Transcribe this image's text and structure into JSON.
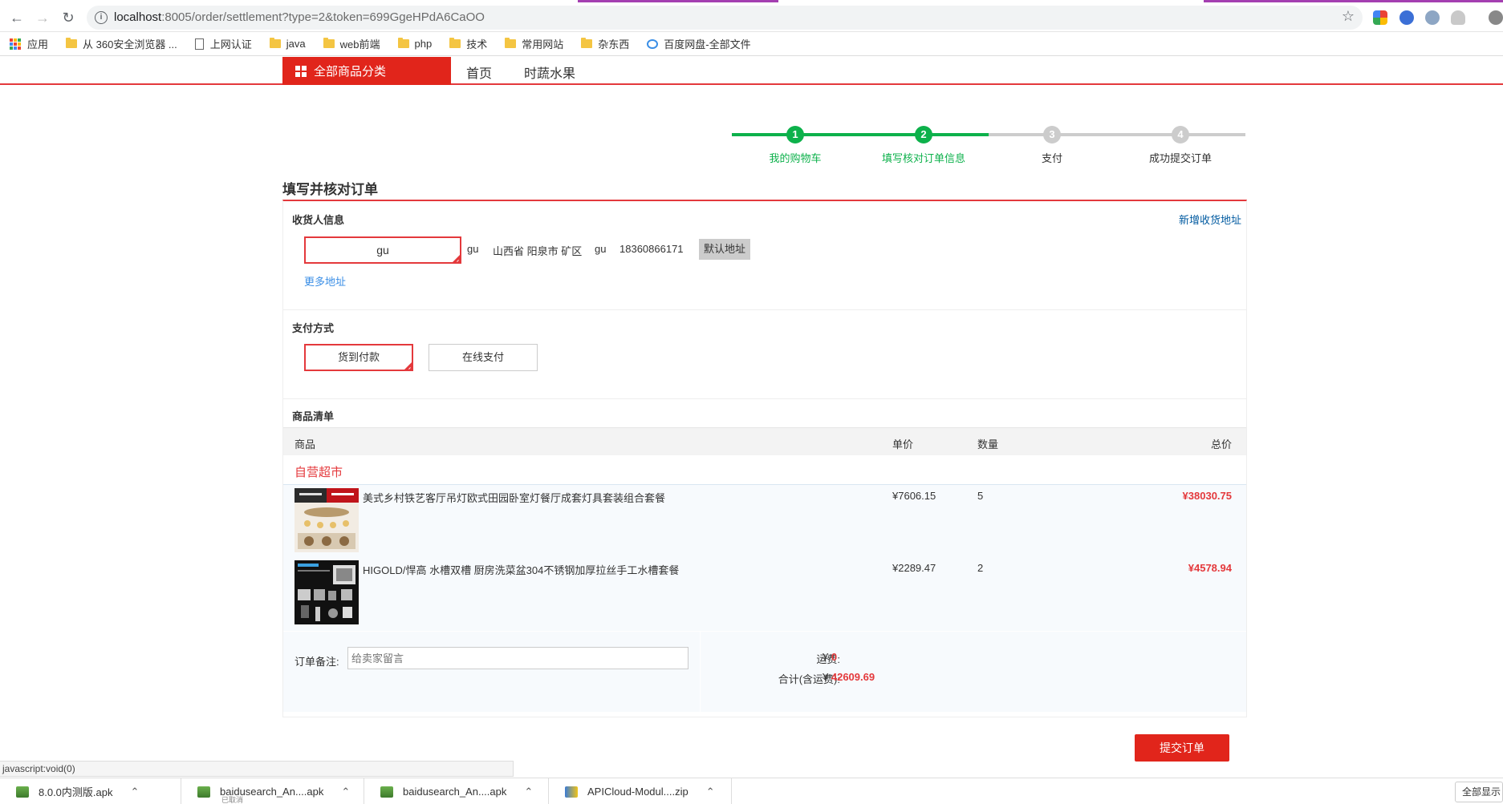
{
  "browser": {
    "url_host": "localhost",
    "url_rest": ":8005/order/settlement?type=2&token=699GgeHPdA6CaOO",
    "bookmarks": [
      "应用",
      "从 360安全浏览器 ...",
      "上网认证",
      "java",
      "web前端",
      "php",
      "技术",
      "常用网站",
      "杂东西",
      "百度网盘-全部文件"
    ]
  },
  "site_nav": {
    "category_label": "全部商品分类",
    "links": [
      "首页",
      "时蔬水果"
    ]
  },
  "stepper": {
    "steps": [
      {
        "num": "1",
        "label": "我的购物车"
      },
      {
        "num": "2",
        "label": "填写核对订单信息"
      },
      {
        "num": "3",
        "label": "支付"
      },
      {
        "num": "4",
        "label": "成功提交订单"
      }
    ],
    "current_step": 2,
    "done_color": "#0db14b",
    "todo_color": "#cccccc"
  },
  "page_title": "填写并核对订单",
  "consignee": {
    "title": "收货人信息",
    "add_link": "新增收货地址",
    "selected_name": "gu",
    "name": "gu",
    "region": "山西省 阳泉市 矿区",
    "detail": "gu",
    "phone": "18360866171",
    "default_badge": "默认地址",
    "more_link": "更多地址"
  },
  "payment": {
    "title": "支付方式",
    "options": [
      "货到付款",
      "在线支付"
    ],
    "selected": "货到付款"
  },
  "goods": {
    "title": "商品清单",
    "headers": {
      "product": "商品",
      "price": "单价",
      "qty": "数量",
      "total": "总价"
    },
    "shop_name": "自营超市",
    "items": [
      {
        "name": "美式乡村铁艺客厅吊灯欧式田园卧室灯餐厅成套灯具套装组合套餐",
        "price": "¥7606.15",
        "qty": "5",
        "total": "¥38030.75"
      },
      {
        "name": "HIGOLD/悍高 水槽双槽 厨房洗菜盆304不锈钢加厚拉丝手工水槽套餐",
        "price": "¥2289.47",
        "qty": "2",
        "total": "¥4578.94"
      }
    ]
  },
  "summary": {
    "remark_label": "订单备注:",
    "remark_placeholder": "给卖家留言",
    "shipping_label": "运费:",
    "shipping_currency": "¥",
    "shipping_value": "0",
    "total_label": "合计(含运费):",
    "total_currency": "¥",
    "total_value": "42609.69"
  },
  "submit_label": "提交订单",
  "status_text": "javascript:void(0)",
  "downloads": [
    {
      "name": "8.0.0内测版.apk",
      "sub": ""
    },
    {
      "name": "baidusearch_An....apk",
      "sub": "已取消"
    },
    {
      "name": "baidusearch_An....apk",
      "sub": ""
    },
    {
      "name": "APICloud-Modul....zip",
      "sub": ""
    }
  ],
  "show_all_label": "全部显示",
  "accent_color": "#e4393c"
}
